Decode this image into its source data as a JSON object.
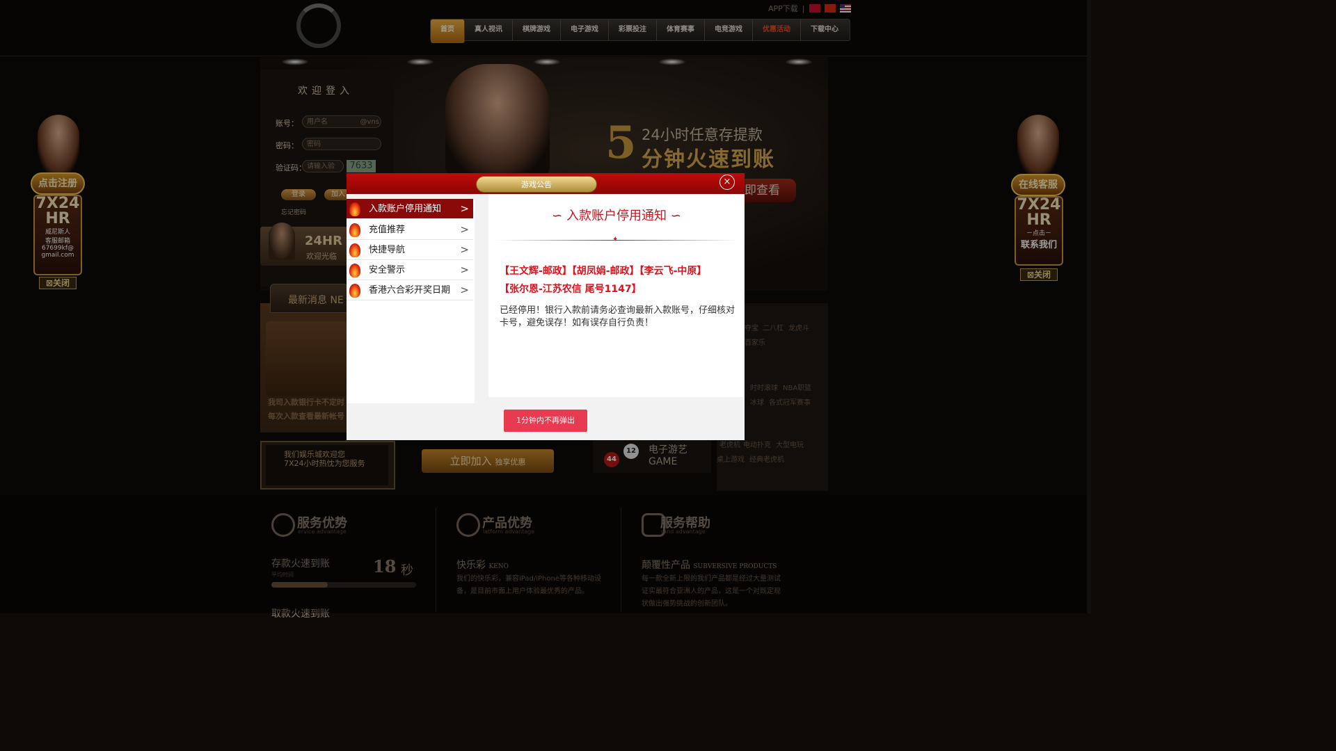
{
  "header": {
    "app_download": "APP下载",
    "nav": [
      {
        "label": "首页"
      },
      {
        "label": "真人视讯"
      },
      {
        "label": "棋牌游戏"
      },
      {
        "label": "电子游戏"
      },
      {
        "label": "彩票投注"
      },
      {
        "label": "体育赛事"
      },
      {
        "label": "电竞游戏"
      },
      {
        "label": "优惠活动"
      },
      {
        "label": "下载中心"
      }
    ]
  },
  "login": {
    "title": "欢迎登入",
    "account_label": "账号：",
    "account_placeholder": "用户名",
    "account_suffix": "@vns",
    "password_label": "密码：",
    "password_placeholder": "密码",
    "captcha_label": "验证码：",
    "captcha_placeholder": "请输入验",
    "captcha_code": "7633",
    "login_button": "登录",
    "join_button": "加入",
    "forgot": "忘记密码"
  },
  "banner": {
    "number": "5",
    "line1": "24小时任意存提款",
    "line2": "分钟火速到账",
    "button": "即查看"
  },
  "service_card": {
    "title": "24HR",
    "subtitle": "欢迎光临"
  },
  "news": {
    "tab": "最新消息 NE",
    "line1": "我司入款银行卡不定时",
    "line2": "每次入款查看最新帐号"
  },
  "welcome_box": {
    "line1": "我们娱乐城欢迎您",
    "line2": "7X24小时热忱为您服务"
  },
  "join_banner": {
    "main": "立即加入",
    "sub": "独享优惠"
  },
  "egame": {
    "title1": "电子游艺",
    "title2": "GAME",
    "balls": [
      "44",
      "12"
    ]
  },
  "right_links": {
    "row1": [
      "夺宝",
      "二八杠",
      "龙虎斗"
    ],
    "row2": "百家乐",
    "row3": [
      "时时滚球",
      "NBA职篮"
    ],
    "row4": [
      "冰球",
      "各式冠军赛事"
    ],
    "row5": [
      "老虎机",
      "电动扑克",
      "大型电玩"
    ],
    "row6": [
      "桌上游戏",
      "经典老虎机"
    ]
  },
  "left_float": {
    "badge": "点击注册",
    "hours": "7X24",
    "hr": "HR",
    "brand": "威尼斯人",
    "mail_label": "客服邮箱",
    "mail1": "67699kf@",
    "mail2": "gmail.com",
    "close": "关闭"
  },
  "right_float": {
    "badge": "在线客服",
    "hours": "7X24",
    "hr": "HR",
    "click": "－点击－",
    "contact": "联系我们",
    "close": "关闭"
  },
  "footer": {
    "col1": {
      "title": "服务优势",
      "sub": "ervice advantage",
      "stat_label": "存款火速到账",
      "stat_sub": "平均时间",
      "stat_value": "18",
      "stat_unit": "秒",
      "progress": 0.39,
      "next": "取款火速到账"
    },
    "col2": {
      "title": "产品优势",
      "sub": "latform advantage",
      "heading": "快乐彩",
      "heading_en": "KENO",
      "text1": "我们的快乐彩，兼容iPad/iPhone等各种移动设",
      "text2": "备，是目前市面上用户体验最优秀的产品。"
    },
    "col3": {
      "title": "服务帮助",
      "sub": "rand advantage",
      "heading": "颠覆性产品",
      "heading_en": "SUBVERSIVE PRODUCTS",
      "text1": "每一款全新上限的我们产品都是经过大量测试",
      "text2": "证实最符合亚洲人的产品，这是一个对既定现",
      "text3": "状做出强势挑战的创新团队。"
    }
  },
  "modal": {
    "title": "游戏公告",
    "close": "×",
    "menu": [
      {
        "label": "入款账户停用通知",
        "active": true
      },
      {
        "label": "充值推荐",
        "active": false
      },
      {
        "label": "快捷导航",
        "active": false
      },
      {
        "label": "安全警示",
        "active": false
      },
      {
        "label": "香港六合彩开奖日期",
        "active": false
      }
    ],
    "content_title": "入款账户停用通知",
    "red_line1": "【王文辉-邮政】【胡凤娟-邮政】【李云飞-中原】",
    "red_line2": "【张尔恩-江苏农信 尾号1147】",
    "body": "已经停用！银行入款前请务必查询最新入款账号，仔细核对卡号，避免误存！如有误存自行负责！",
    "footer_button": "1分钟内不再弹出"
  }
}
